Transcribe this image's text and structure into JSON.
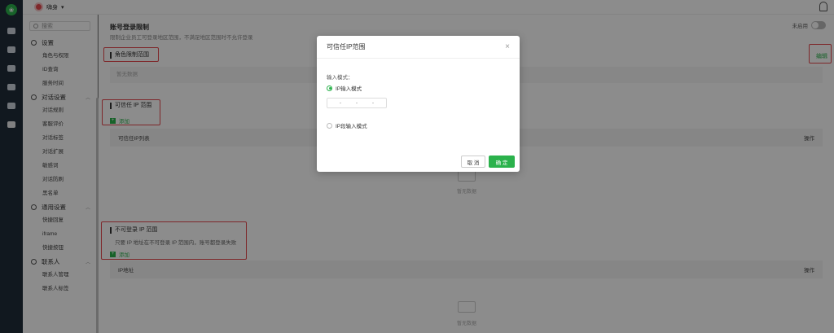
{
  "topbar": {
    "brand": "嗨身",
    "brand_caret": "▾"
  },
  "sidebar": {
    "search_placeholder": "搜索",
    "groups": [
      {
        "label": "设置",
        "items": [
          "角色与权限",
          "ID查询",
          "服务时间"
        ]
      },
      {
        "label": "对话设置",
        "items": [
          "对话规则",
          "客服评价",
          "对话标签",
          "对话扩展",
          "敏感词",
          "对话防刷",
          "黑名单"
        ]
      },
      {
        "label": "通用设置",
        "items": [
          "快捷回复",
          "iframe",
          "快捷按钮"
        ]
      },
      {
        "label": "联系人",
        "items": [
          "联系人管理",
          "联系人标签"
        ]
      }
    ]
  },
  "main": {
    "title": "账号登录限制",
    "subtitle": "限制企业员工可登录地区范围，不满足地区范围时不允许登录",
    "toggle_label": "未启用",
    "role_section": "角色限制范围",
    "edit": "编辑",
    "empty": "暂无数据",
    "trusted_section": "可信任 IP 范围",
    "add": "添加",
    "trusted_table": {
      "col1": "可信任IP列表",
      "col2": "操作"
    },
    "untrusted_section": "不可登录 IP 范围",
    "untrusted_desc": "只要 IP 地址在不可登录 IP 范围内，账号都登录失败",
    "untrusted_table": {
      "col1": "IP地址",
      "col2": "操作"
    }
  },
  "modal": {
    "title": "可信任IP范围",
    "close": "×",
    "input_mode_label": "输入模式：",
    "radio_ip": "IP输入模式",
    "radio_range": "IP段输入模式",
    "ip_sep": [
      "-",
      "-",
      "-"
    ],
    "cancel": "取 消",
    "ok": "确 定"
  },
  "colors": {
    "accent": "#2bb24c",
    "highlight": "#e5484d",
    "rail": "#1f2d3a"
  }
}
